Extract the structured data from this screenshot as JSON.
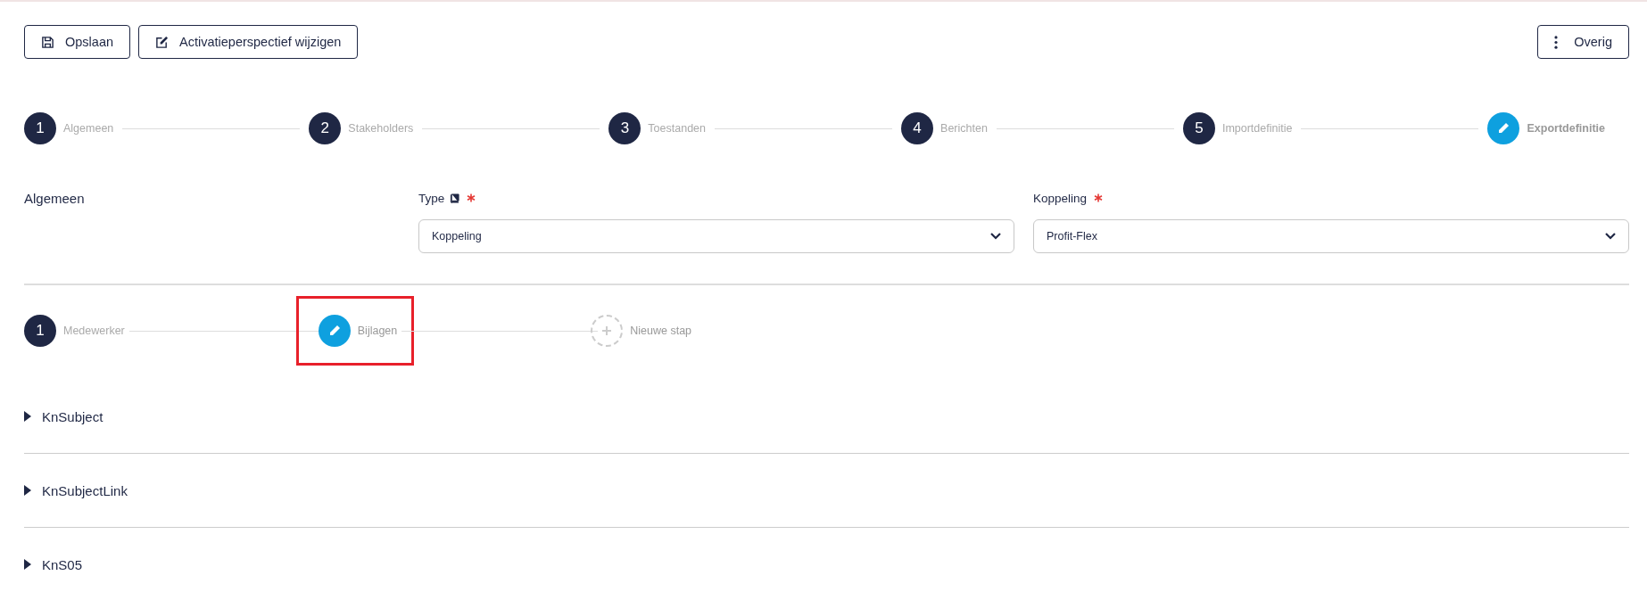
{
  "toolbar": {
    "buttons": [
      {
        "label": "Opslaan"
      },
      {
        "label": "Activatieperspectief wijzigen"
      }
    ],
    "more_button": {
      "label": "Overig"
    }
  },
  "steps": [
    {
      "number": "1",
      "label": "Algemeen",
      "kind": "done"
    },
    {
      "number": "2",
      "label": "Stakeholders",
      "kind": "done"
    },
    {
      "number": "3",
      "label": "Toestanden",
      "kind": "done"
    },
    {
      "number": "4",
      "label": "Berichten",
      "kind": "done"
    },
    {
      "number": "5",
      "label": "Importdefinitie",
      "kind": "done"
    },
    {
      "label": "Exportdefinitie",
      "kind": "current"
    }
  ],
  "form": {
    "section_title": "Algemeen",
    "fields": [
      {
        "label": "Type",
        "has_book_icon": true,
        "required": true,
        "value": "Koppeling"
      },
      {
        "label": "Koppeling",
        "has_book_icon": false,
        "required": true,
        "value": "Profit-Flex"
      }
    ]
  },
  "substeps": [
    {
      "number": "1",
      "label": "Medewerker",
      "kind": "done",
      "highlighted": false
    },
    {
      "label": "Bijlagen",
      "kind": "current",
      "highlighted": true
    },
    {
      "label": "Nieuwe stap",
      "kind": "new",
      "highlighted": false
    }
  ],
  "sections": [
    {
      "title": "KnSubject",
      "expanded": false
    },
    {
      "title": "KnSubjectLink",
      "expanded": false
    },
    {
      "title": "KnS05",
      "expanded": false
    }
  ]
}
